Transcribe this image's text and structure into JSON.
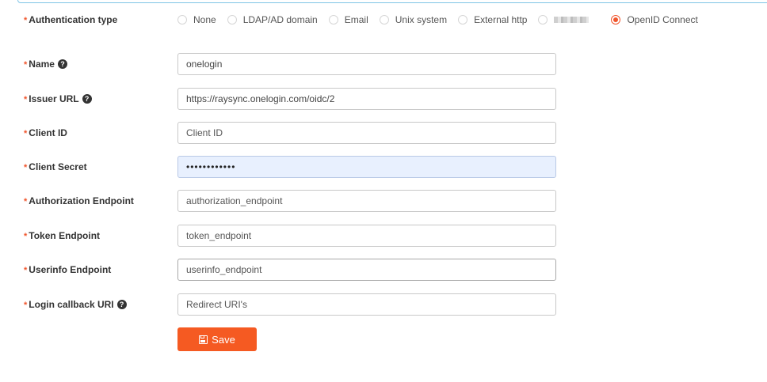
{
  "auth_type": {
    "label": "Authentication type",
    "options": [
      "None",
      "LDAP/AD domain",
      "Email",
      "Unix system",
      "External http",
      "",
      "OpenID Connect"
    ],
    "selected": "OpenID Connect"
  },
  "form": {
    "name": {
      "label": "Name",
      "value": "onelogin",
      "help": "?"
    },
    "issuer_url": {
      "label": "Issuer URL",
      "value": "https://raysync.onelogin.com/oidc/2",
      "help": "?"
    },
    "client_id": {
      "label": "Client ID",
      "placeholder": "Client ID"
    },
    "client_secret": {
      "label": "Client Secret",
      "value": "••••••••••••"
    },
    "authorization_endpoint": {
      "label": "Authorization Endpoint",
      "placeholder": "authorization_endpoint"
    },
    "token_endpoint": {
      "label": "Token Endpoint",
      "placeholder": "token_endpoint"
    },
    "userinfo_endpoint": {
      "label": "Userinfo Endpoint",
      "placeholder": "userinfo_endpoint"
    },
    "login_callback_uri": {
      "label": "Login callback URI",
      "placeholder": "Redirect URI's",
      "help": "?"
    }
  },
  "required_mark": "*",
  "save_button": {
    "label": "Save",
    "icon": "save-icon"
  },
  "colors": {
    "accent": "#f55a22",
    "required": "#f0552c",
    "autofill": "#e8f0fe"
  }
}
